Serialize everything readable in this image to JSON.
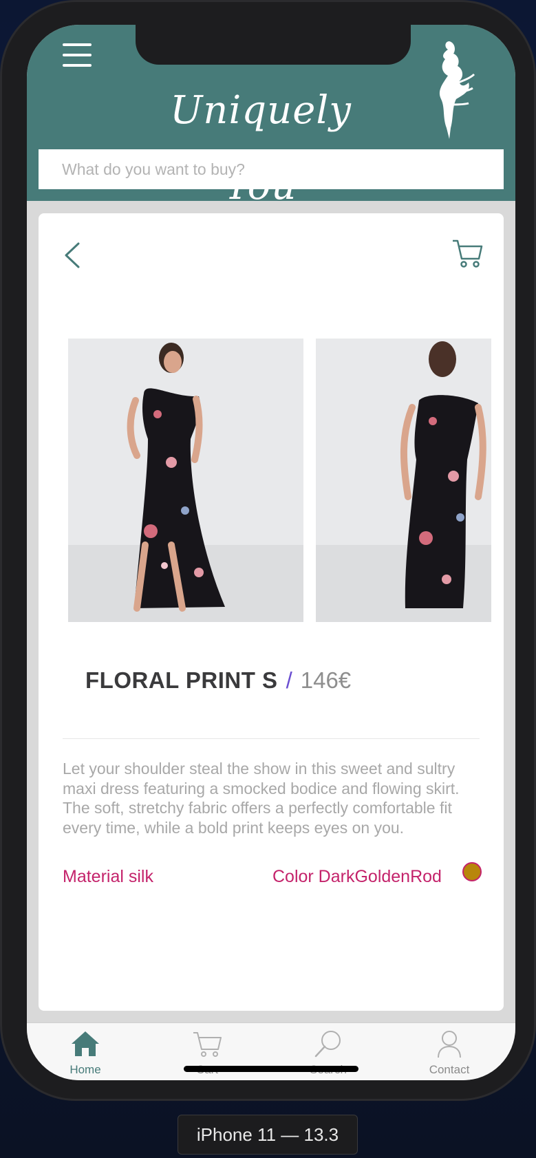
{
  "app": {
    "brand": "Uniquely You"
  },
  "search": {
    "placeholder": "What do you want to buy?"
  },
  "product": {
    "name": "FLORAL PRINT S",
    "separator": "/",
    "price": "146€",
    "description": "Let your shoulder steal the show in this sweet and sultry maxi dress featuring a smocked bodice and flowing skirt. The soft, stretchy fabric offers a perfectly comfortable fit every time, while a bold print keeps eyes on you.",
    "material": "Material silk",
    "color": "Color DarkGoldenRod",
    "color_swatch": "#b8860b"
  },
  "tabs": [
    {
      "label": "Home",
      "icon": "home-icon",
      "active": true
    },
    {
      "label": "Cart",
      "icon": "cart-icon",
      "active": false
    },
    {
      "label": "Search",
      "icon": "search-icon",
      "active": false
    },
    {
      "label": "Contact",
      "icon": "person-icon",
      "active": false
    }
  ],
  "simulator": {
    "device_label": "iPhone 11 — 13.3"
  },
  "colors": {
    "header": "#477b79",
    "accent_text": "#c4236b",
    "slash": "#6b4fd1"
  }
}
